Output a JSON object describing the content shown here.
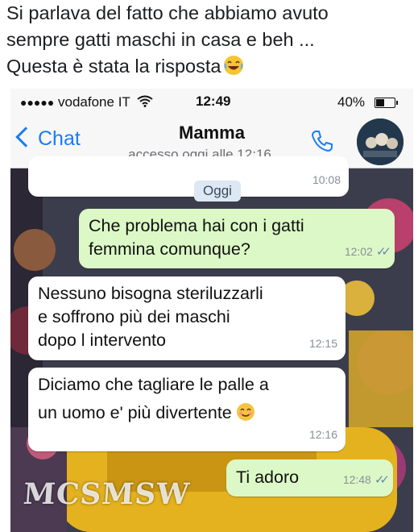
{
  "post": {
    "caption_lines": [
      "Si parlava del fatto che abbiamo avuto",
      "sempre gatti maschi in casa e beh ...",
      "Questa è stata la risposta"
    ],
    "caption_emoji": "laughing-emoji"
  },
  "status_bar": {
    "signal": "●●●●●",
    "carrier": "vodafone IT",
    "wifi_icon": "wifi-icon",
    "time": "12:49",
    "battery": "40%",
    "battery_level": 0.4
  },
  "nav": {
    "back_label": "Chat",
    "contact_name": "Mamma",
    "last_seen": "...accesso oggi alle 12:16",
    "call_icon": "phone-icon"
  },
  "chat": {
    "top_partial_time": "10:08",
    "date_label": "Oggi",
    "messages": [
      {
        "direction": "out",
        "lines": [
          "Che problema hai con i gatti",
          "femmina comunque?"
        ],
        "time": "12:02",
        "read": true
      },
      {
        "direction": "in",
        "lines": [
          "Nessuno bisogna steriluzzarli",
          "e soffrono più dei maschi",
          "dopo l intervento"
        ],
        "time": "12:15"
      },
      {
        "direction": "in",
        "lines": [
          "Diciamo che tagliare le palle a",
          "un uomo e' più divertente"
        ],
        "time": "12:16",
        "emoji": "smiling-emoji"
      },
      {
        "direction": "out",
        "lines": [
          "Ti adoro"
        ],
        "time": "12:48",
        "read": true
      }
    ]
  },
  "watermark": "MCSMSW",
  "colors": {
    "ios_blue": "#1a7cf5",
    "outgoing_bubble": "#dcf8c6",
    "incoming_bubble": "#ffffff",
    "read_ticks": "#6b86ad"
  }
}
